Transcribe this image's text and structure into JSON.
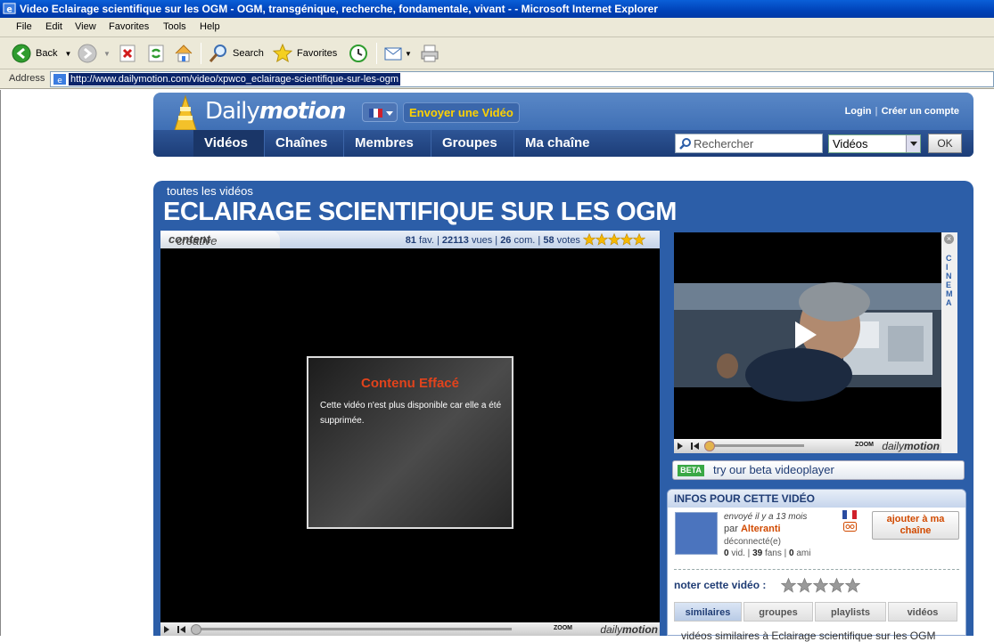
{
  "window": {
    "title": "Video Eclairage scientifique sur les OGM - OGM, transgénique, recherche, fondamentale, vivant - - Microsoft Internet Explorer"
  },
  "menu": {
    "items": [
      "File",
      "Edit",
      "View",
      "Favorites",
      "Tools",
      "Help"
    ]
  },
  "toolbar": {
    "back_label": "Back",
    "search_label": "Search",
    "favorites_label": "Favorites"
  },
  "address": {
    "label": "Address",
    "url": "http://www.dailymotion.com/video/xpwco_eclairage-scientifique-sur-les-ogm"
  },
  "site": {
    "logo_a": "Daily",
    "logo_b": "motion",
    "upload": "Envoyer une Vidéo",
    "login": "Login",
    "signup": "Créer un compte",
    "nav": [
      "Vidéos",
      "Chaînes",
      "Membres",
      "Groupes",
      "Ma chaîne"
    ],
    "search_placeholder": "Rechercher",
    "search_scope": "Vidéos",
    "search_ok": "OK"
  },
  "page": {
    "breadcrumb": "toutes les vidéos",
    "title": "ECLAIRAGE SCIENTIFIQUE SUR LES OGM"
  },
  "player": {
    "provider_a": "creative",
    "provider_b": "content",
    "fav": "81",
    "fav_label": "fav.",
    "views": "22113",
    "views_label": "vues",
    "comments": "26",
    "comments_label": "com.",
    "votes": "58",
    "votes_label": "votes",
    "rating_stars": 5,
    "deleted_title": "Contenu Effacé",
    "deleted_msg": "Cette vidéo n'est plus disponible car elle a été supprimée."
  },
  "sidebar": {
    "cinema": "CINEMA",
    "zoom": "ZOOM",
    "brand_a": "daily",
    "brand_b": "motion",
    "beta_tag": "BETA",
    "beta_text": "try our beta videoplayer",
    "info_title": "INFOS POUR CETTE VIDÉO",
    "sent": "envoyé il y a 13 mois",
    "by_label": "par",
    "user": "Alteranti",
    "status": "déconnecté(e)",
    "vids": "0",
    "vids_label": "vid.",
    "fans": "39",
    "fans_label": "fans",
    "friends": "0",
    "friends_label": "ami",
    "add_channel_1": "ajouter à ma",
    "add_channel_2": "chaîne",
    "rate_label": "noter cette vidéo :",
    "tabs": [
      "similaires",
      "groupes",
      "playlists",
      "vidéos"
    ],
    "similar_text": "vidéos similaires à Eclairage scientifique sur les OGM"
  },
  "colors": {
    "brand_blue": "#2c5ea8",
    "accent_orange": "#d14a00",
    "deleted_red": "#e1431c",
    "upload_yellow": "#ffd200"
  }
}
